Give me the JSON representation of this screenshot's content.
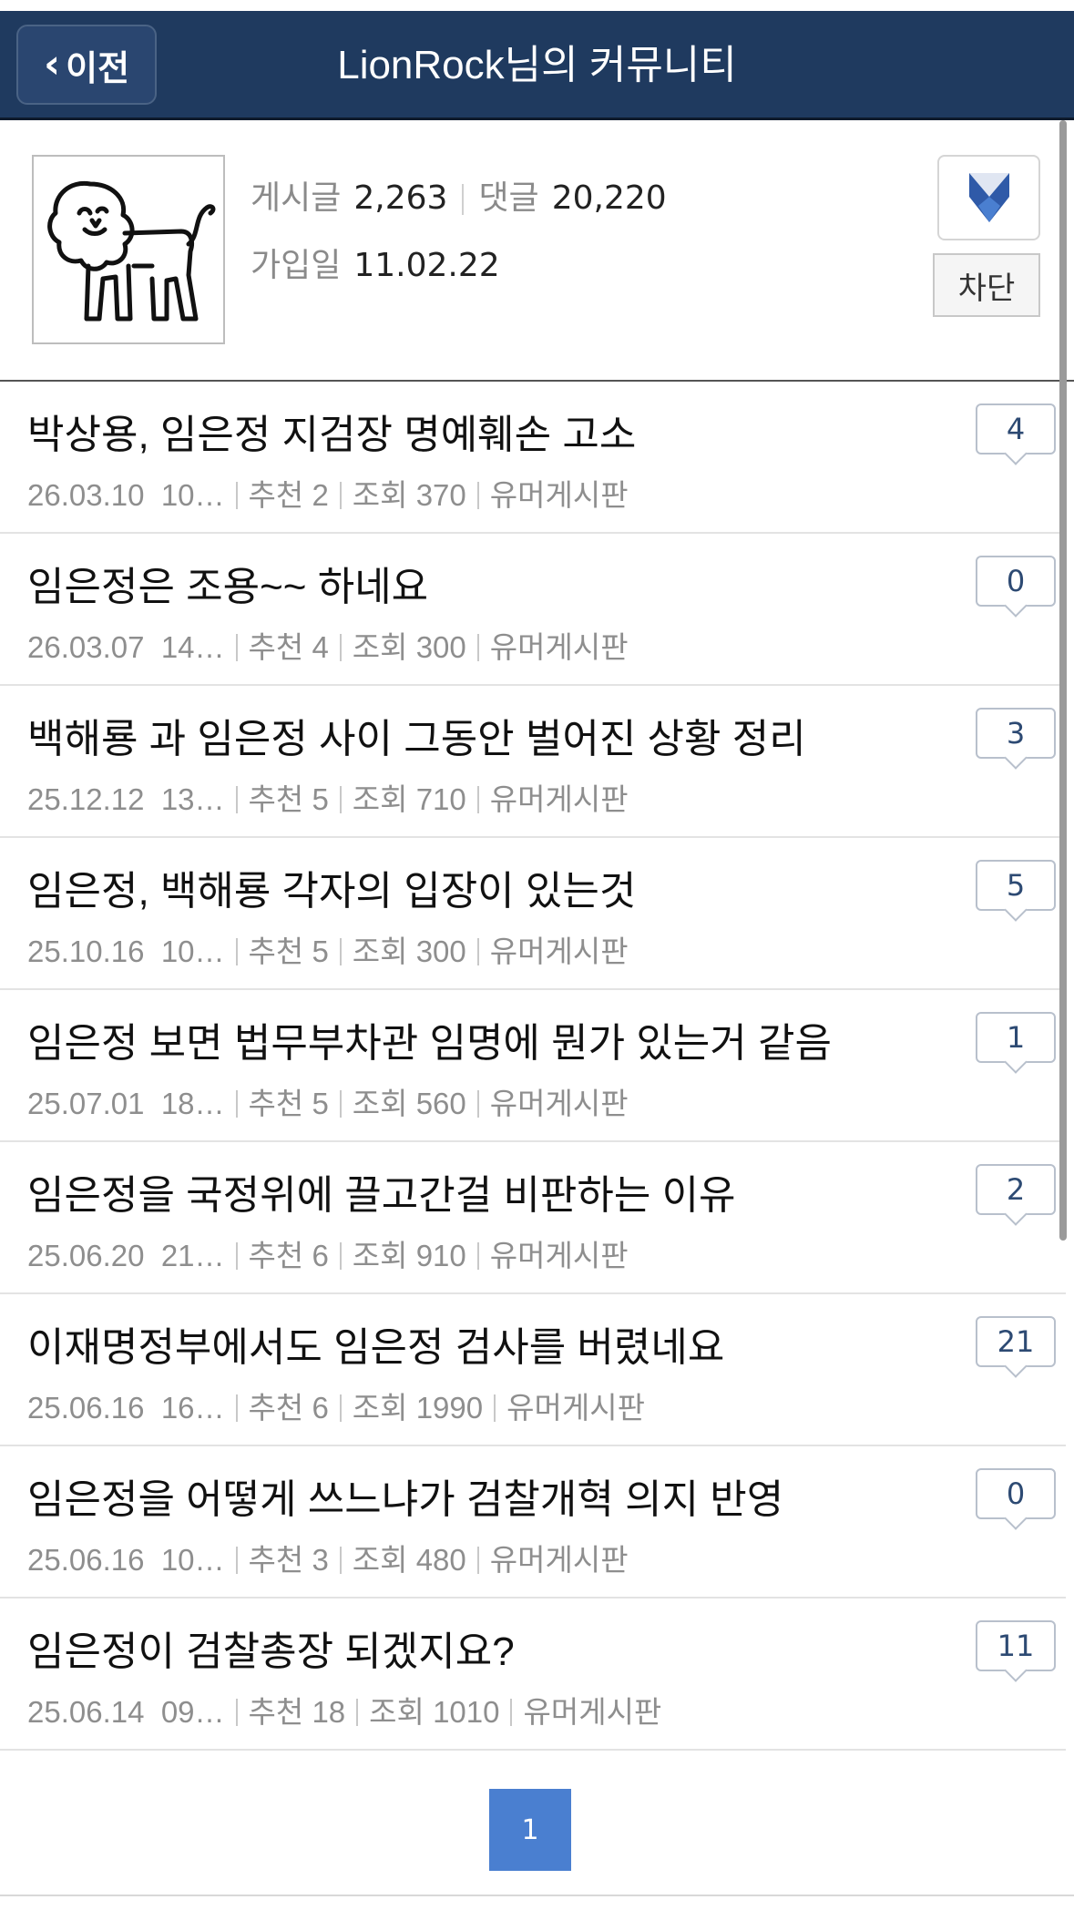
{
  "header": {
    "back_label": "이전",
    "title": "LionRock님의 커뮤니티",
    "bg_color": "#1f3a5f"
  },
  "profile": {
    "avatar_icon": "lion-icon",
    "posts_label": "게시글",
    "posts_count": "2,263",
    "comments_label": "댓글",
    "comments_count": "20,220",
    "joined_label": "가입일",
    "joined_date": "11.02.22",
    "block_label": "차단"
  },
  "posts": [
    {
      "title": "박상용, 임은정 지검장 명예훼손 고소",
      "date": "26.03.10",
      "time": "10…",
      "rec_label": "추천",
      "rec": "2",
      "views_label": "조회",
      "views": "370",
      "board": "유머게시판",
      "comments": "4"
    },
    {
      "title": "임은정은 조용~~ 하네요",
      "date": "26.03.07",
      "time": "14…",
      "rec_label": "추천",
      "rec": "4",
      "views_label": "조회",
      "views": "300",
      "board": "유머게시판",
      "comments": "0"
    },
    {
      "title": "백해룡 과 임은정 사이 그동안 벌어진 상황 정리",
      "date": "25.12.12",
      "time": "13…",
      "rec_label": "추천",
      "rec": "5",
      "views_label": "조회",
      "views": "710",
      "board": "유머게시판",
      "comments": "3"
    },
    {
      "title": "임은정, 백해룡 각자의 입장이 있는것",
      "date": "25.10.16",
      "time": "10…",
      "rec_label": "추천",
      "rec": "5",
      "views_label": "조회",
      "views": "300",
      "board": "유머게시판",
      "comments": "5"
    },
    {
      "title": "임은정 보면 법무부차관 임명에 뭔가 있는거 같음",
      "date": "25.07.01",
      "time": "18…",
      "rec_label": "추천",
      "rec": "5",
      "views_label": "조회",
      "views": "560",
      "board": "유머게시판",
      "comments": "1"
    },
    {
      "title": "임은정을 국정위에 끌고간걸 비판하는 이유",
      "date": "25.06.20",
      "time": "21…",
      "rec_label": "추천",
      "rec": "6",
      "views_label": "조회",
      "views": "910",
      "board": "유머게시판",
      "comments": "2"
    },
    {
      "title": "이재명정부에서도 임은정 검사를 버렸네요",
      "date": "25.06.16",
      "time": "16…",
      "rec_label": "추천",
      "rec": "6",
      "views_label": "조회",
      "views": "1990",
      "board": "유머게시판",
      "comments": "21"
    },
    {
      "title": "임은정을 어떻게 쓰느냐가 검찰개혁 의지 반영",
      "date": "25.06.16",
      "time": "10…",
      "rec_label": "추천",
      "rec": "3",
      "views_label": "조회",
      "views": "480",
      "board": "유머게시판",
      "comments": "0"
    },
    {
      "title": "임은정이 검찰총장 되겠지요?",
      "date": "25.06.14",
      "time": "09…",
      "rec_label": "추천",
      "rec": "18",
      "views_label": "조회",
      "views": "1010",
      "board": "유머게시판",
      "comments": "11"
    }
  ],
  "pagination": {
    "current": "1",
    "active_color": "#4a7fd0"
  }
}
